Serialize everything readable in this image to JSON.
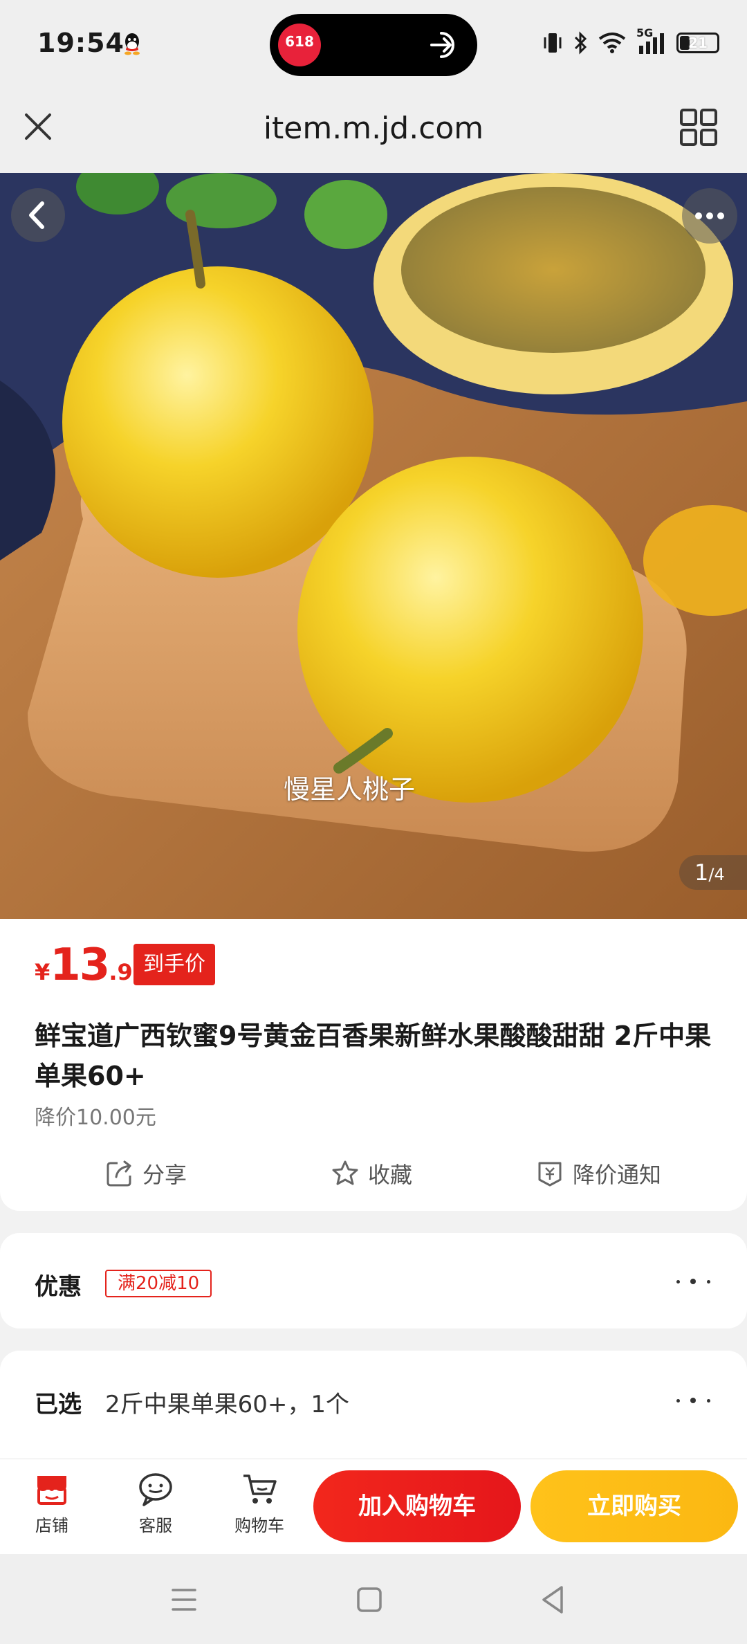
{
  "status_bar": {
    "time": "19:54",
    "network": "5G",
    "battery_level": "21",
    "pill_app_label": "618"
  },
  "browser": {
    "url": "item.m.jd.com",
    "close_icon": "close-icon",
    "menu_icon": "grid-icon"
  },
  "gallery": {
    "watermark": "慢星人桃子",
    "page_current": "1",
    "page_total": "/4"
  },
  "product": {
    "currency": "¥",
    "price_int": "13",
    "price_dec": ".90",
    "price_tag": "到手价",
    "title": "鲜宝道广西钦蜜9号黄金百香果新鲜水果酸酸甜甜 2斤中果单果60+",
    "price_drop": "降价10.00元"
  },
  "actions": {
    "share": "分享",
    "favorite": "收藏",
    "price_alert": "降价通知"
  },
  "coupon": {
    "label": "优惠",
    "tag": "满20减10"
  },
  "selection": {
    "label": "已选",
    "value": "2斤中果单果60+，1个"
  },
  "bottom_bar": {
    "store": "店铺",
    "service": "客服",
    "cart": "购物车",
    "add_to_cart": "加入购物车",
    "buy_now": "立即购买"
  },
  "colors": {
    "accent_red": "#e4231c",
    "buy_yellow": "#fbb812"
  }
}
